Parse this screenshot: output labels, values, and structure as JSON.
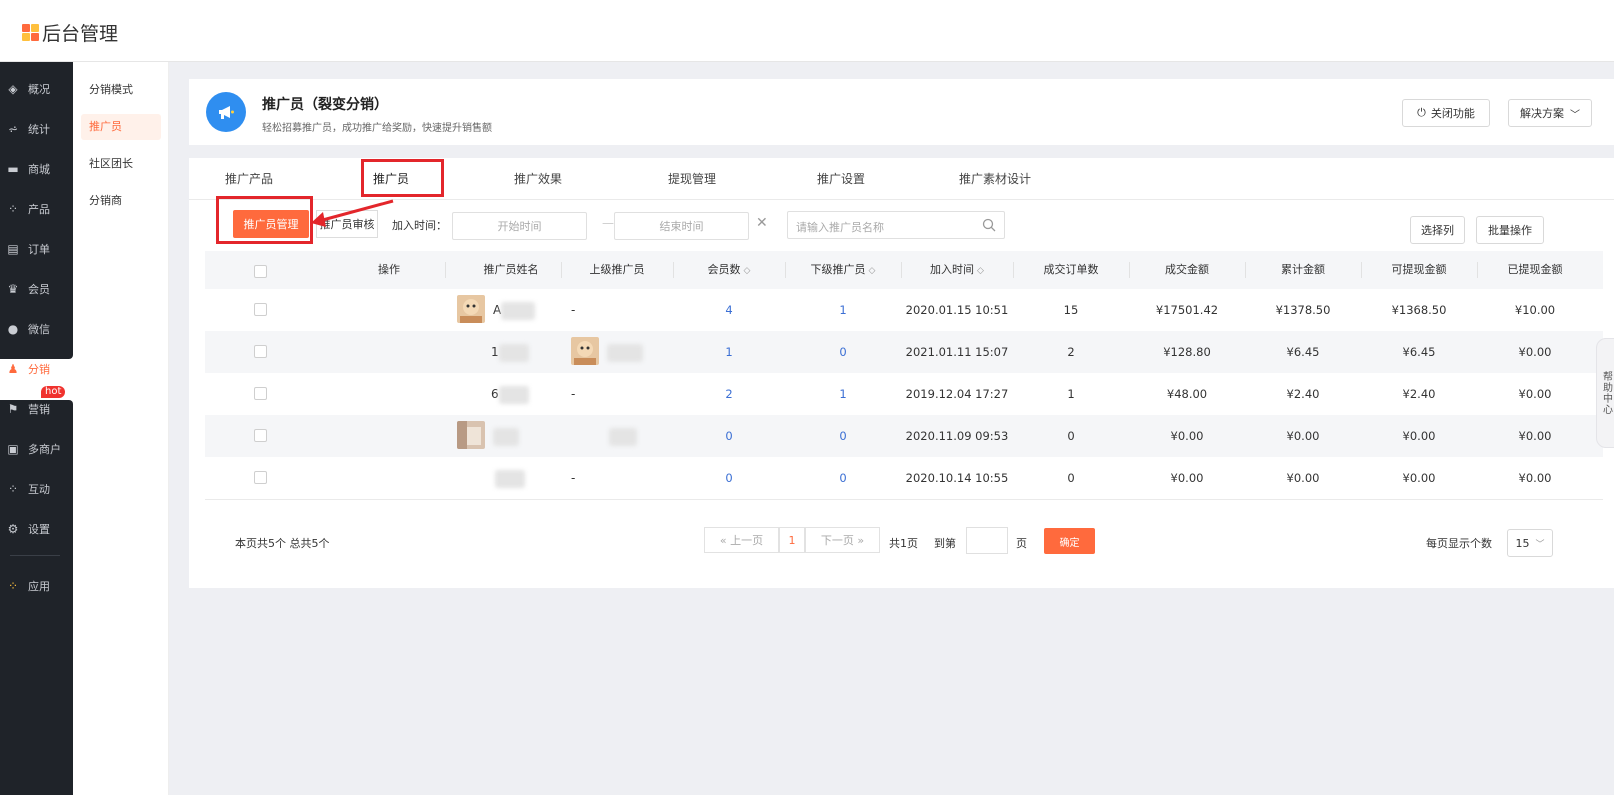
{
  "app": {
    "title": "后台管理",
    "logo_colors": [
      "#ff6a3d",
      "#ffc03d",
      "#2f8ef0",
      "#ff6a3d"
    ]
  },
  "sidebar": {
    "items": [
      {
        "label": "概况",
        "icon": "layers-icon"
      },
      {
        "label": "统计",
        "icon": "chart-icon"
      },
      {
        "label": "商城",
        "icon": "shop-icon"
      },
      {
        "label": "产品",
        "icon": "grid-icon"
      },
      {
        "label": "订单",
        "icon": "order-icon"
      },
      {
        "label": "会员",
        "icon": "crown-icon"
      },
      {
        "label": "微信",
        "icon": "wechat-icon"
      },
      {
        "label": "分销",
        "icon": "distribution-icon",
        "active": true
      },
      {
        "label": "营销",
        "icon": "flag-icon",
        "badge": "hot"
      },
      {
        "label": "多商户",
        "icon": "merchant-icon"
      },
      {
        "label": "互动",
        "icon": "interact-icon"
      },
      {
        "label": "设置",
        "icon": "gear-icon"
      },
      {
        "label": "应用",
        "icon": "apps-icon"
      }
    ]
  },
  "subnav": {
    "items": [
      {
        "label": "分销模式"
      },
      {
        "label": "推广员",
        "active": true
      },
      {
        "label": "社区团长"
      },
      {
        "label": "分销商"
      }
    ]
  },
  "header": {
    "title": "推广员（裂变分销）",
    "subtitle": "轻松招募推广员，成功推广给奖励，快速提升销售额",
    "close_feature": "关闭功能",
    "solution": "解决方案"
  },
  "tabs": [
    "推广产品",
    "推广员",
    "推广效果",
    "提现管理",
    "推广设置",
    "推广素材设计"
  ],
  "active_tab": "推广员",
  "subtabs": {
    "manage": "推广员管理",
    "review": "推广员审核"
  },
  "filters": {
    "join_time_label": "加入时间：",
    "start_placeholder": "开始时间",
    "end_placeholder": "结束时间",
    "date_sep": "—",
    "search_placeholder": "请输入推广员名称",
    "select_columns": "选择列",
    "batch": "批量操作"
  },
  "table": {
    "headers": [
      "操作",
      "推广员姓名",
      "上级推广员",
      "会员数",
      "下级推广员",
      "加入时间",
      "成交订单数",
      "成交金额",
      "累计金额",
      "可提现金额",
      "已提现金额"
    ],
    "rows": [
      {
        "name": "A",
        "parent": "-",
        "members": "4",
        "subs": "1",
        "joined": "2020.01.15 10:51",
        "orders": "15",
        "deal": "¥17501.42",
        "total": "¥1378.50",
        "withdrawable": "¥1368.50",
        "withdrawn": "¥10.00"
      },
      {
        "name": "1",
        "parent": "",
        "members": "1",
        "subs": "0",
        "joined": "2021.01.11 15:07",
        "orders": "2",
        "deal": "¥128.80",
        "total": "¥6.45",
        "withdrawable": "¥6.45",
        "withdrawn": "¥0.00"
      },
      {
        "name": "6",
        "parent": "-",
        "members": "2",
        "subs": "1",
        "joined": "2019.12.04 17:27",
        "orders": "1",
        "deal": "¥48.00",
        "total": "¥2.40",
        "withdrawable": "¥2.40",
        "withdrawn": "¥0.00"
      },
      {
        "name": "",
        "parent": "",
        "members": "0",
        "subs": "0",
        "joined": "2020.11.09 09:53",
        "orders": "0",
        "deal": "¥0.00",
        "total": "¥0.00",
        "withdrawable": "¥0.00",
        "withdrawn": "¥0.00"
      },
      {
        "name": "",
        "parent": "-",
        "members": "0",
        "subs": "0",
        "joined": "2020.10.14 10:55",
        "orders": "0",
        "deal": "¥0.00",
        "total": "¥0.00",
        "withdrawable": "¥0.00",
        "withdrawn": "¥0.00"
      }
    ]
  },
  "pagination": {
    "summary": "本页共5个  总共5个",
    "prev": "« 上一页",
    "current": "1",
    "next": "下一页 »",
    "total_pages": "共1页",
    "goto": "到第",
    "page_unit": "页",
    "confirm": "确定",
    "per_page_label": "每页显示个数",
    "per_page": "15"
  },
  "help": "帮助中心"
}
